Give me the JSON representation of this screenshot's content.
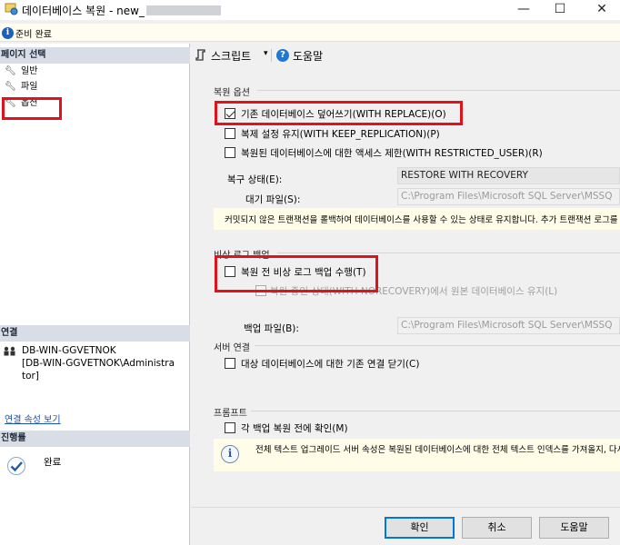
{
  "window": {
    "title": "데이터베이스 복원 - new_",
    "minimize": "—",
    "maximize": "☐",
    "close": "✕"
  },
  "status": {
    "text": "준비 완료"
  },
  "left": {
    "page_select_header": "페이지 선택",
    "pages": [
      "일반",
      "파일",
      "옵션"
    ],
    "connection_header": "연결",
    "server": "DB-WIN-GGVETNOK",
    "user_line1": "[DB-WIN-GGVETNOK\\Administra",
    "user_line2": "tor]",
    "view_connection_link": "연결 속성 보기",
    "progress_header": "진행률",
    "progress_status": "완료"
  },
  "toolbar": {
    "script_label": "스크립트",
    "dropdown_arrow": "▾",
    "help_label": "도움말"
  },
  "restore_options": {
    "header": "복원 옵션",
    "with_replace": "기존 데이터베이스 덮어쓰기(WITH REPLACE)(O)",
    "keep_replication": "복제 설정 유지(WITH KEEP_REPLICATION)(P)",
    "restricted_user": "복원된 데이터베이스에 대한 액세스 제한(WITH RESTRICTED_USER)(R)",
    "recovery_state_label": "복구 상태(E):",
    "recovery_state_value": "RESTORE WITH RECOVERY",
    "standby_label": "대기 파일(S):",
    "standby_value": "C:\\Program Files\\Microsoft SQL Server\\MSSQ",
    "note": "커밋되지 않은 트랜잭션을 롤백하여 데이터베이스를 사용할 수 있는 상태로 유지합니다. 추가 트랜잭션 로그를 복"
  },
  "tail_log": {
    "header": "비상 로그 백업",
    "take_tail_log": "복원 전 비상 로그 백업 수행(T)",
    "leave_norecovery": "복원 중인 상태(WITH NORECOVERY)에서 원본 데이터베이스 유지(L)",
    "backup_file_label": "백업 파일(B):",
    "backup_file_value": "C:\\Program Files\\Microsoft SQL Server\\MSSQ"
  },
  "server_connections": {
    "header": "서버 연결",
    "close_existing": "대상 데이터베이스에 대한 기존 연결 닫기(C)"
  },
  "prompt": {
    "header": "프롬프트",
    "confirm_each": "각 백업 복원 전에 확인(M)",
    "info_note": "전체 텍스트 업그레이드 서버 속성은 복원된 데이터베이스에 대한 전체 텍스트 인덱스를 가져올지, 다시"
  },
  "buttons": {
    "ok": "확인",
    "cancel": "취소",
    "help": "도움말"
  },
  "colors": {
    "highlight_red": "#e0121c",
    "accent_blue": "#0078d7",
    "link_blue": "#1a4fb5"
  },
  "icons": {
    "info": "info-icon",
    "wrench": "wrench-icon",
    "script": "script-icon",
    "help": "help-icon",
    "connection": "connection-icon",
    "check": "check-circle-icon"
  }
}
